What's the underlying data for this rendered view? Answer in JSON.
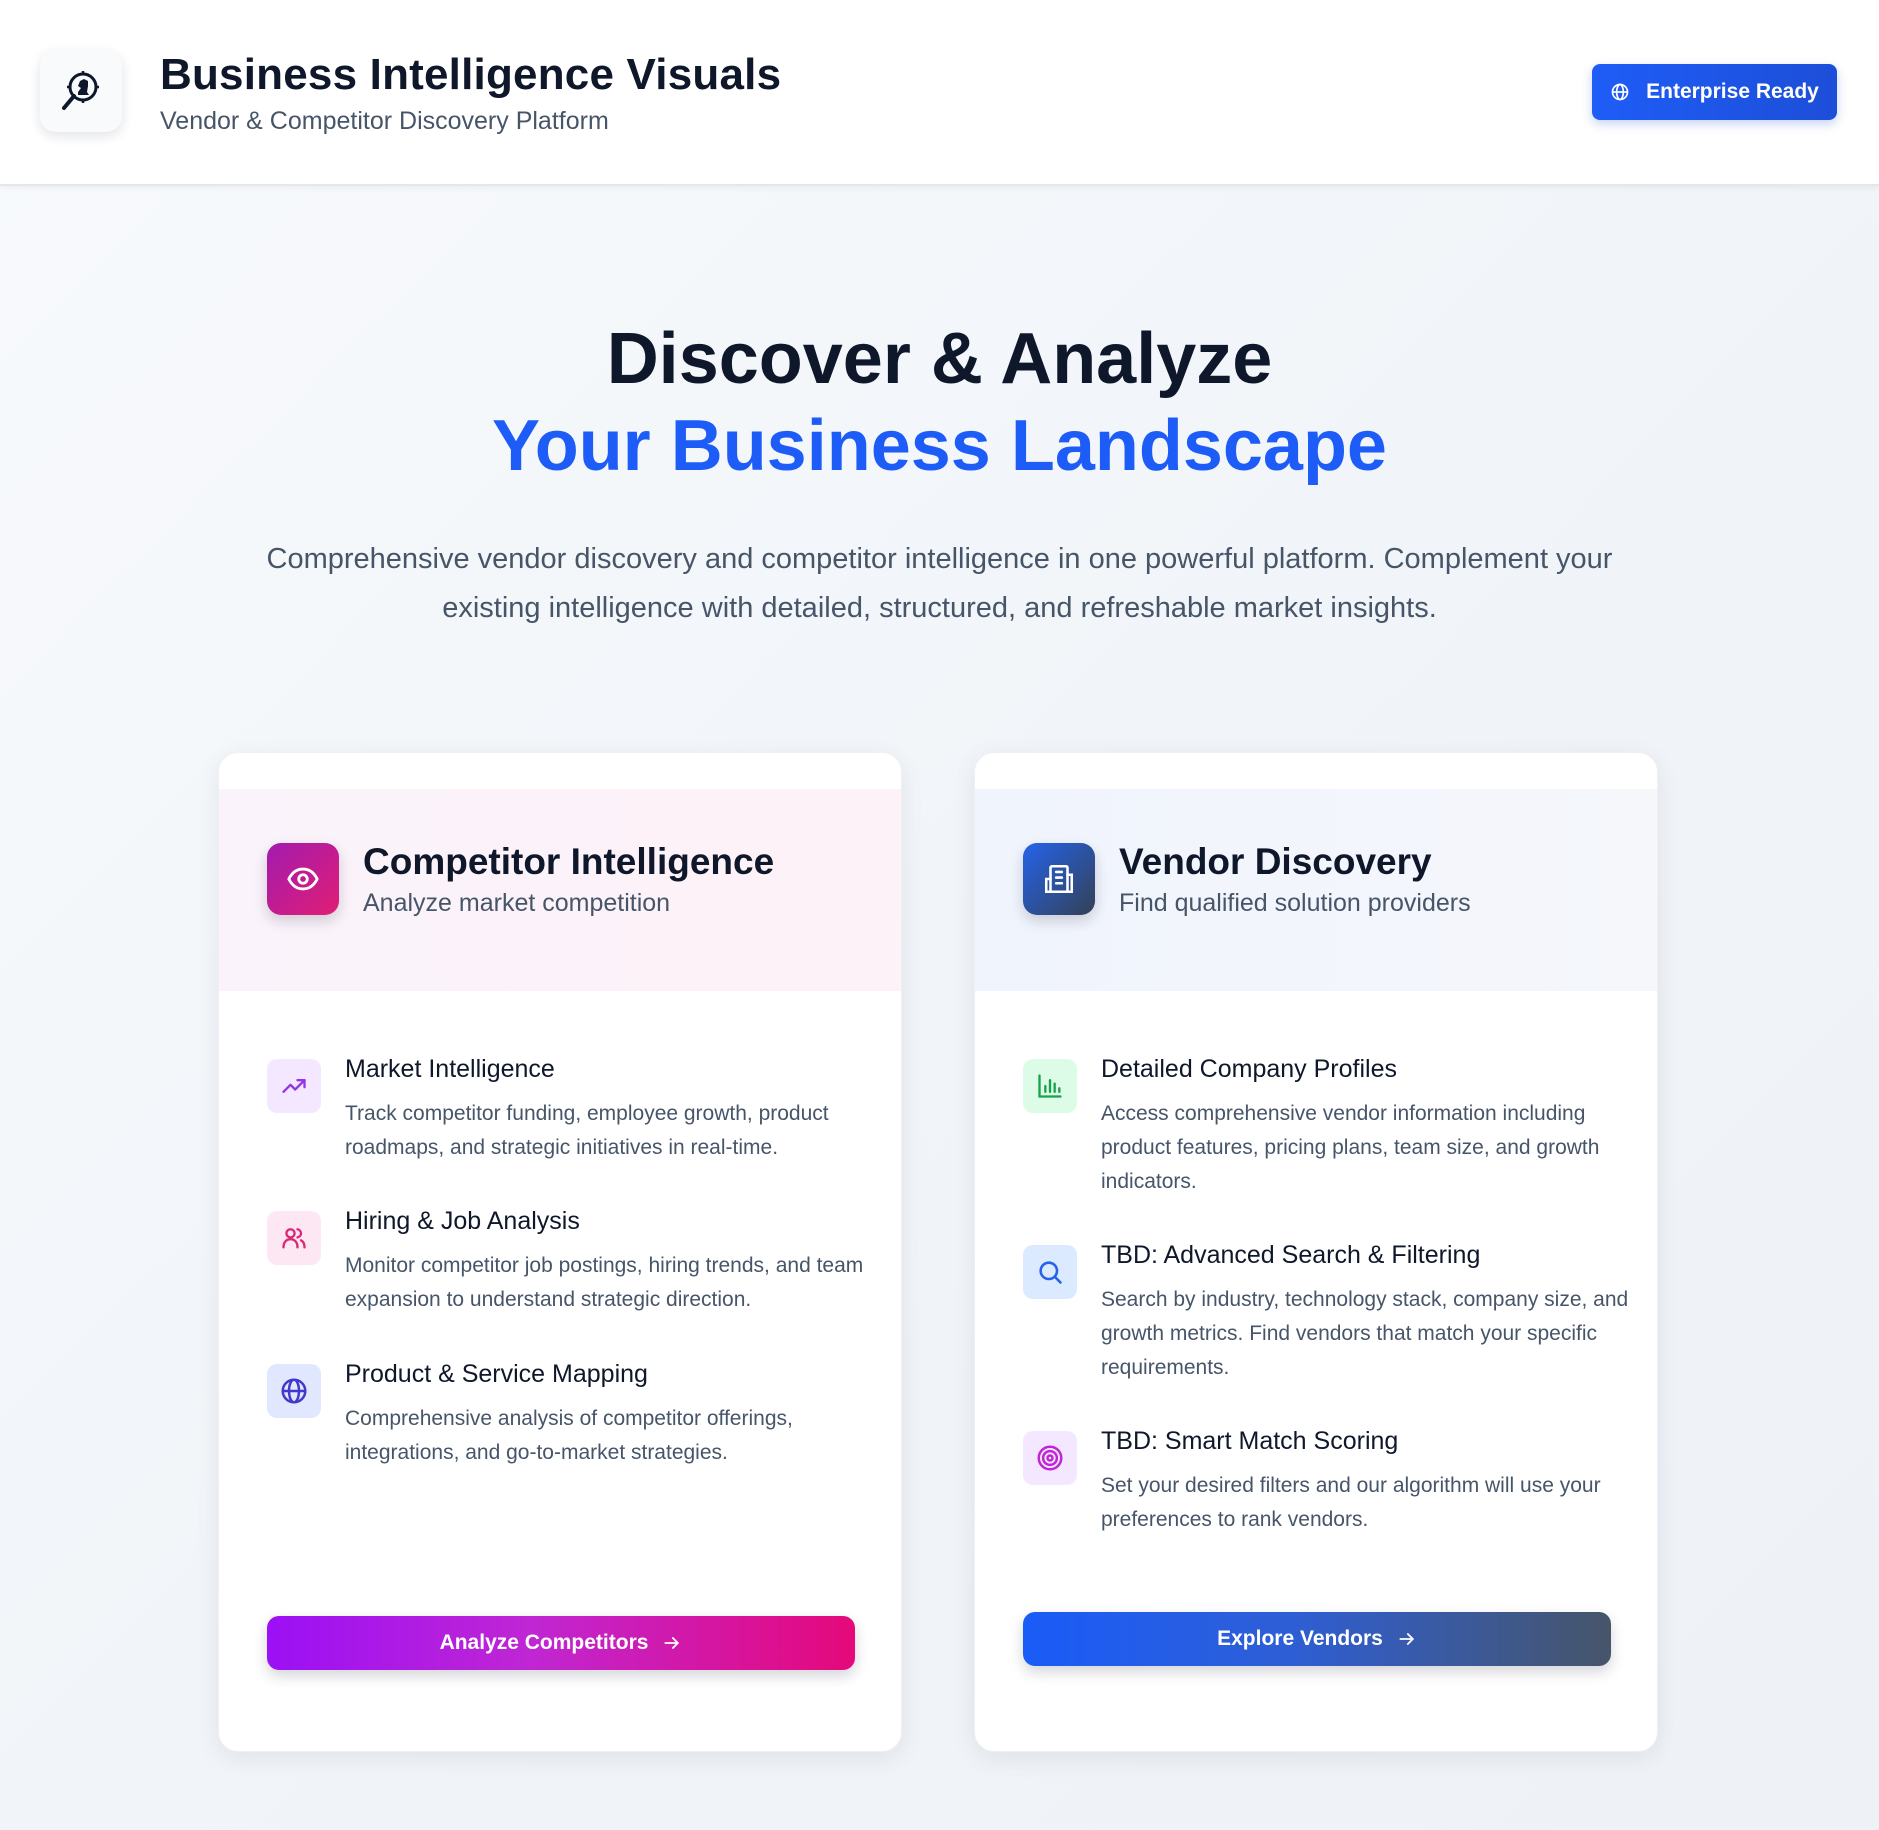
{
  "header": {
    "title": "Business Intelligence Visuals",
    "subtitle": "Vendor & Competitor Discovery Platform",
    "badge_label": "Enterprise Ready"
  },
  "hero": {
    "line1": "Discover & Analyze",
    "line2": "Your Business Landscape",
    "description": "Comprehensive vendor discovery and competitor intelligence in one powerful platform. Complement your existing intelligence with detailed, structured, and refreshable market insights."
  },
  "competitor_card": {
    "title": "Competitor Intelligence",
    "subtitle": "Analyze market competition",
    "features": [
      {
        "title": "Market Intelligence",
        "desc": "Track competitor funding, employee growth, product roadmaps, and strategic initiatives in real-time.",
        "icon": "trending-up-icon"
      },
      {
        "title": "Hiring & Job Analysis",
        "desc": "Monitor competitor job postings, hiring trends, and team expansion to understand strategic direction.",
        "icon": "users-icon"
      },
      {
        "title": "Product & Service Mapping",
        "desc": "Comprehensive analysis of competitor offerings, integrations, and go-to-market strategies.",
        "icon": "globe-icon"
      }
    ],
    "cta_label": "Analyze Competitors"
  },
  "vendor_card": {
    "title": "Vendor Discovery",
    "subtitle": "Find qualified solution providers",
    "features": [
      {
        "title": "Detailed Company Profiles",
        "desc": "Access comprehensive vendor information including product features, pricing plans, team size, and growth indicators.",
        "icon": "bar-chart-icon"
      },
      {
        "title": "TBD: Advanced Search & Filtering",
        "desc": "Search by industry, technology stack, company size, and growth metrics. Find vendors that match your specific requirements.",
        "icon": "search-icon"
      },
      {
        "title": "TBD: Smart Match Scoring",
        "desc": "Set your desired filters and our algorithm will use your preferences to rank vendors.",
        "icon": "target-icon"
      }
    ],
    "cta_label": "Explore Vendors"
  },
  "colors": {
    "accent_blue": "#1d5cf6",
    "competitor_gradient": [
      "#9b10f5",
      "#e5097a"
    ],
    "vendor_gradient": [
      "#1a5cf8",
      "#475569"
    ]
  }
}
